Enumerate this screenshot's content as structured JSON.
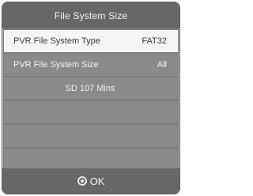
{
  "dialog": {
    "title": "File System Size",
    "rows": [
      {
        "label": "PVR File System Type",
        "value": "FAT32",
        "selected": true
      },
      {
        "label": "PVR File System Size",
        "value": "All",
        "selected": false
      }
    ],
    "info_text": "SD 107 Mins",
    "empty_rows": 4,
    "footer": {
      "icon": "ok-circle-icon",
      "label": "OK"
    }
  }
}
